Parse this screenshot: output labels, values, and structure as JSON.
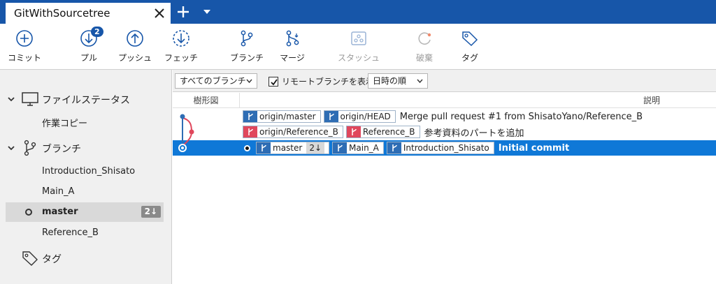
{
  "tab": {
    "title": "GitWithSourcetree"
  },
  "toolbar": {
    "commit": "コミット",
    "pull": "プル",
    "pull_badge": "2",
    "push": "プッシュ",
    "fetch": "フェッチ",
    "branch": "ブランチ",
    "merge": "マージ",
    "stash": "スタッシュ",
    "discard": "破棄",
    "tag": "タグ"
  },
  "sidebar": {
    "file_status": "ファイルステータス",
    "working_copy": "作業コピー",
    "branches": "ブランチ",
    "branch_items": [
      "Introduction_Shisato",
      "Main_A",
      "master",
      "Reference_B"
    ],
    "master_badge": "2↓",
    "tags": "タグ"
  },
  "filter": {
    "branch_select": "すべてのブランチ",
    "show_remote": "リモートブランチを表示",
    "sort_select": "日時の順"
  },
  "columns": {
    "graph": "樹形図",
    "description": "説明"
  },
  "commits": [
    {
      "refs": [
        "origin/master",
        "origin/HEAD"
      ],
      "message": "Merge pull request #1 from ShisatoYano/Reference_B"
    },
    {
      "refs": [
        "origin/Reference_B",
        "Reference_B"
      ],
      "message": "参考資料のパートを追加"
    },
    {
      "refs": [
        "master",
        "Main_A",
        "Introduction_Shisato"
      ],
      "master_count": "2↓",
      "message": "Initial commit"
    }
  ],
  "colors": {
    "accent": "#1756a9",
    "selected_row": "#0f78d7",
    "ref_blue": "#2e6db4",
    "ref_red": "#e0475c"
  }
}
